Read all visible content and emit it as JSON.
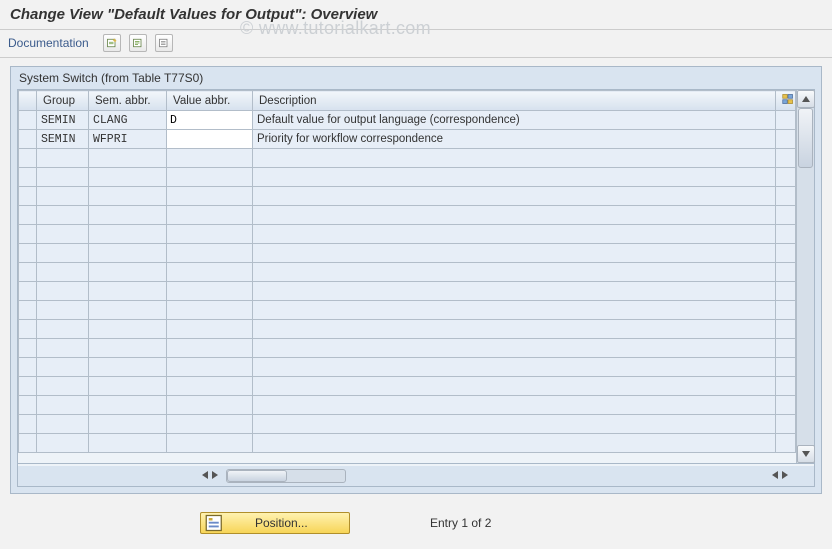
{
  "title": "Change View \"Default Values for Output\": Overview",
  "watermark": "© www.tutorialkart.com",
  "toolbar": {
    "documentation_label": "Documentation"
  },
  "panel": {
    "title": "System Switch (from Table T77S0)"
  },
  "columns": {
    "group": "Group",
    "sem": "Sem. abbr.",
    "val": "Value abbr.",
    "desc": "Description"
  },
  "rows": [
    {
      "group": "SEMIN",
      "sem": "CLANG",
      "val": "D",
      "desc": "Default value for output language (correspondence)"
    },
    {
      "group": "SEMIN",
      "sem": "WFPRI",
      "val": "",
      "desc": "Priority for workflow correspondence"
    }
  ],
  "footer": {
    "position_label": "Position...",
    "entry_text": "Entry 1 of 2"
  }
}
